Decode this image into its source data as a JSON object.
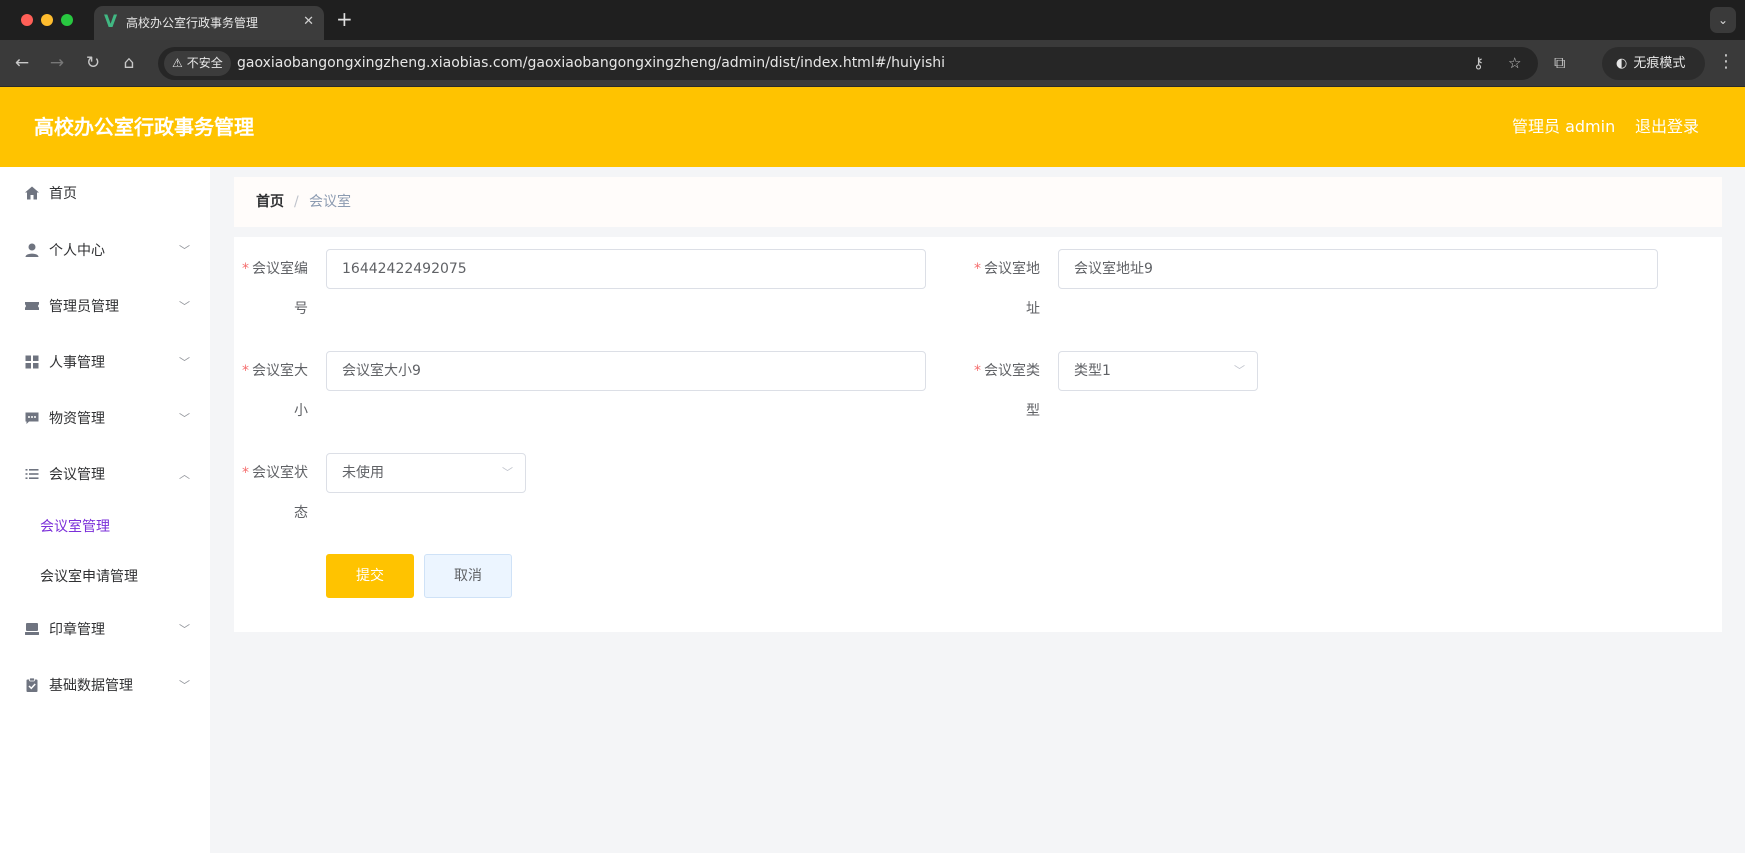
{
  "browser": {
    "tab_title": "高校办公室行政事务管理",
    "tab_close": "✕",
    "new_tab": "+",
    "security_label": "不安全",
    "url": "gaoxiaobangongxingzheng.xiaobias.com/gaoxiaobangongxingzheng/admin/dist/index.html#/huiyishi",
    "incognito_label": "无痕模式"
  },
  "header": {
    "title": "高校办公室行政事务管理",
    "user_label": "管理员 admin",
    "logout_label": "退出登录",
    "accent_color": "#ffc300"
  },
  "sidebar": {
    "items": [
      {
        "label": "首页",
        "icon": "home-icon"
      },
      {
        "label": "个人中心",
        "icon": "user-icon"
      },
      {
        "label": "管理员管理",
        "icon": "ticket-icon"
      },
      {
        "label": "人事管理",
        "icon": "grid-icon"
      },
      {
        "label": "物资管理",
        "icon": "message-icon"
      },
      {
        "label": "会议管理",
        "icon": "list-icon"
      },
      {
        "label": "印章管理",
        "icon": "stamp-icon"
      },
      {
        "label": "基础数据管理",
        "icon": "clipboard-icon"
      }
    ],
    "sub_items": [
      {
        "label": "会议室管理"
      },
      {
        "label": "会议室申请管理"
      }
    ],
    "active_color": "#7b2fd9"
  },
  "breadcrumb": {
    "home": "首页",
    "separator": "/",
    "current": "会议室"
  },
  "form": {
    "required_mark": "*",
    "number_label": "会议室编号",
    "number_value": "16442422492075",
    "address_label": "会议室地址",
    "address_value": "会议室地址9",
    "size_label": "会议室大小",
    "size_value": "会议室大小9",
    "type_label": "会议室类型",
    "type_value": "类型1",
    "status_label": "会议室状态",
    "status_value": "未使用",
    "submit_label": "提交",
    "cancel_label": "取消"
  }
}
